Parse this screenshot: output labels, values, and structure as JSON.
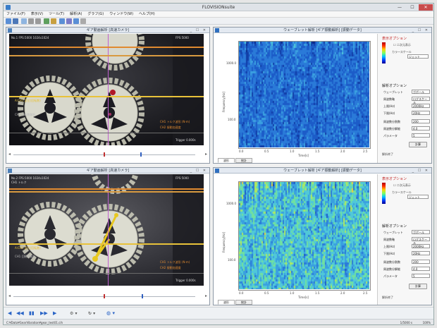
{
  "window": {
    "title": "FLOVISIONsuite",
    "min": "—",
    "max": "☐",
    "close": "✕"
  },
  "menu": [
    "ファイル(F)",
    "表示(V)",
    "ツール(T)",
    "解析(A)",
    "グラフ(G)",
    "ウィンドウ(W)",
    "ヘルプ(H)"
  ],
  "video_top": {
    "title": "ギア動画解析 [高速カメラ]",
    "overlay_lines": [
      "No.1 FPS:5000 1024x1024",
      "FPS:5000"
    ],
    "legend": "A:CH1 変位(回転数)",
    "legend2": "CH1 回転数解析",
    "info": [
      "CH1 トルク波形 (N·m)",
      "CH2 振動加速度"
    ],
    "bottom": "Trigger 0.000s"
  },
  "video_bottom": {
    "title": "ギア動画解析 [高速カメラ]",
    "overlay_lines": [
      "No.2 FPS:5000 1024x1024",
      "FPS:5000",
      "CH1 トルク"
    ],
    "legend": "A:CH1 変位(回転数)",
    "legend2": "CH1 回転数解析",
    "info": [
      "CH1 トルク波形 (N·m)",
      "CH2 振動加速度"
    ],
    "bottom": "Trigger 0.000s"
  },
  "wave_top": {
    "title": "ウェーブレット解析 [ギア振動解析] [振動データ]",
    "ylabel": "Frequency[Hz]",
    "xlabel": "Time[s]",
    "yticks": [
      "1000.0",
      "100.0"
    ],
    "xticks": [
      "0.0",
      "0.5",
      "1.0",
      "1.5",
      "2.0",
      "2.5"
    ],
    "side": {
      "g1": "表示オプション",
      "chk": "二次元表示",
      "scale": "カラースケール",
      "scale_val": "ジェット",
      "g2": "解析オプション",
      "rows": [
        {
          "label": "ウェーブレット",
          "value": "ガボール"
        },
        {
          "label": "周波数軸",
          "value": "ログスケール"
        },
        {
          "label": "上限(Hz)",
          "value": "2000Hz"
        },
        {
          "label": "下限(Hz)",
          "value": "20Hz"
        },
        {
          "label": "周波数分割数",
          "value": "200"
        },
        {
          "label": "周波数分解能",
          "value": "4.0"
        },
        {
          "label": "パラメータ",
          "value": "5"
        }
      ],
      "btn": "計算",
      "note": "解析終了"
    },
    "tabs": [
      "波形",
      "統計"
    ]
  },
  "wave_bottom": {
    "title": "ウェーブレット解析 [ギア振動解析] [振動データ]",
    "ylabel": "Frequency[Hz]",
    "xlabel": "Time[s]",
    "yticks": [
      "1000.0",
      "100.0"
    ],
    "xticks": [
      "0.0",
      "0.5",
      "1.0",
      "1.5",
      "2.0",
      "2.5"
    ],
    "side": {
      "g1": "表示オプション",
      "chk": "二次元表示",
      "scale": "カラースケール",
      "scale_val": "ジェット",
      "g2": "解析オプション",
      "rows": [
        {
          "label": "ウェーブレット",
          "value": "ガボール"
        },
        {
          "label": "周波数軸",
          "value": "ログスケール"
        },
        {
          "label": "上限(Hz)",
          "value": "2000Hz"
        },
        {
          "label": "下限(Hz)",
          "value": "20Hz"
        },
        {
          "label": "周波数分割数",
          "value": "200"
        },
        {
          "label": "周波数分解能",
          "value": "4.0"
        },
        {
          "label": "パラメータ",
          "value": "5"
        }
      ],
      "btn": "計算",
      "note": "解析終了"
    },
    "tabs": [
      "波形",
      "統計"
    ]
  },
  "transport": [
    "◀",
    "◀◀",
    "▮▮",
    "▶▶",
    "▶"
  ],
  "status": {
    "left": "C:¥Data¥GearVibration¥gear_test01.cih",
    "right": "1/5000 s",
    "zoom": "100%"
  },
  "colors": {
    "accent": "#2a64c6",
    "waveform_yellow": "#e8c23a",
    "waveform_orange": "#e08a30"
  }
}
